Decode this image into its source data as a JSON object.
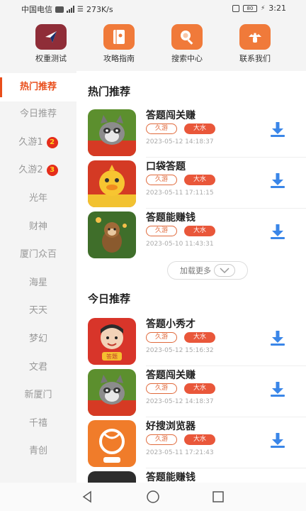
{
  "status_bar": {
    "carrier": "中国电信",
    "speed": "273K/s",
    "battery": "80",
    "time": "3:21"
  },
  "top_nav": [
    {
      "label": "权重测试",
      "icon": "compass-icon",
      "color": "#c73a2f"
    },
    {
      "label": "攻略指南",
      "icon": "book-icon",
      "color": "#f07a3a"
    },
    {
      "label": "搜索中心",
      "icon": "magnifier-icon",
      "color": "#f07a3a"
    },
    {
      "label": "联系我们",
      "icon": "mushroom-icon",
      "color": "#f07a3a"
    }
  ],
  "sidebar": {
    "items": [
      {
        "label": "热门推荐",
        "active": true
      },
      {
        "label": "今日推荐"
      },
      {
        "label": "久游1",
        "badge": "2"
      },
      {
        "label": "久游2",
        "badge": "3"
      },
      {
        "label": "光年"
      },
      {
        "label": "财神"
      },
      {
        "label": "厦门众百"
      },
      {
        "label": "海星"
      },
      {
        "label": "天天"
      },
      {
        "label": "梦幻"
      },
      {
        "label": "文君"
      },
      {
        "label": "新厦门"
      },
      {
        "label": "千禧"
      },
      {
        "label": "青创"
      }
    ]
  },
  "hot_section": {
    "title": "热门推荐",
    "apps": [
      {
        "name": "答题闯关赚",
        "tag1": "久游",
        "tag2": "大水",
        "date": "2023-05-12 14:18:37",
        "thumb": "raccoon"
      },
      {
        "name": "口袋答题",
        "tag1": "久游",
        "tag2": "大水",
        "date": "2023-05-11 17:11:15",
        "thumb": "duck"
      },
      {
        "name": "答题能赚钱",
        "tag1": "久游",
        "tag2": "大水",
        "date": "2023-05-10 11:43:31",
        "thumb": "monkey"
      }
    ],
    "load_more": "加载更多"
  },
  "today_section": {
    "title": "今日推荐",
    "apps": [
      {
        "name": "答题小秀才",
        "tag1": "久游",
        "tag2": "大水",
        "date": "2023-05-12 15:16:32",
        "thumb": "scholar"
      },
      {
        "name": "答题闯关赚",
        "tag1": "久游",
        "tag2": "大水",
        "date": "2023-05-12 14:18:37",
        "thumb": "raccoon"
      },
      {
        "name": "好搜浏览器",
        "tag1": "久游",
        "tag2": "大水",
        "date": "2023-05-11 17:21:43",
        "thumb": "browser"
      },
      {
        "name": "答题能赚钱",
        "thumb": "monkey"
      }
    ]
  },
  "colors": {
    "accent": "#e94e1b",
    "download": "#3a86e8",
    "tag_fill": "#e9573a"
  }
}
